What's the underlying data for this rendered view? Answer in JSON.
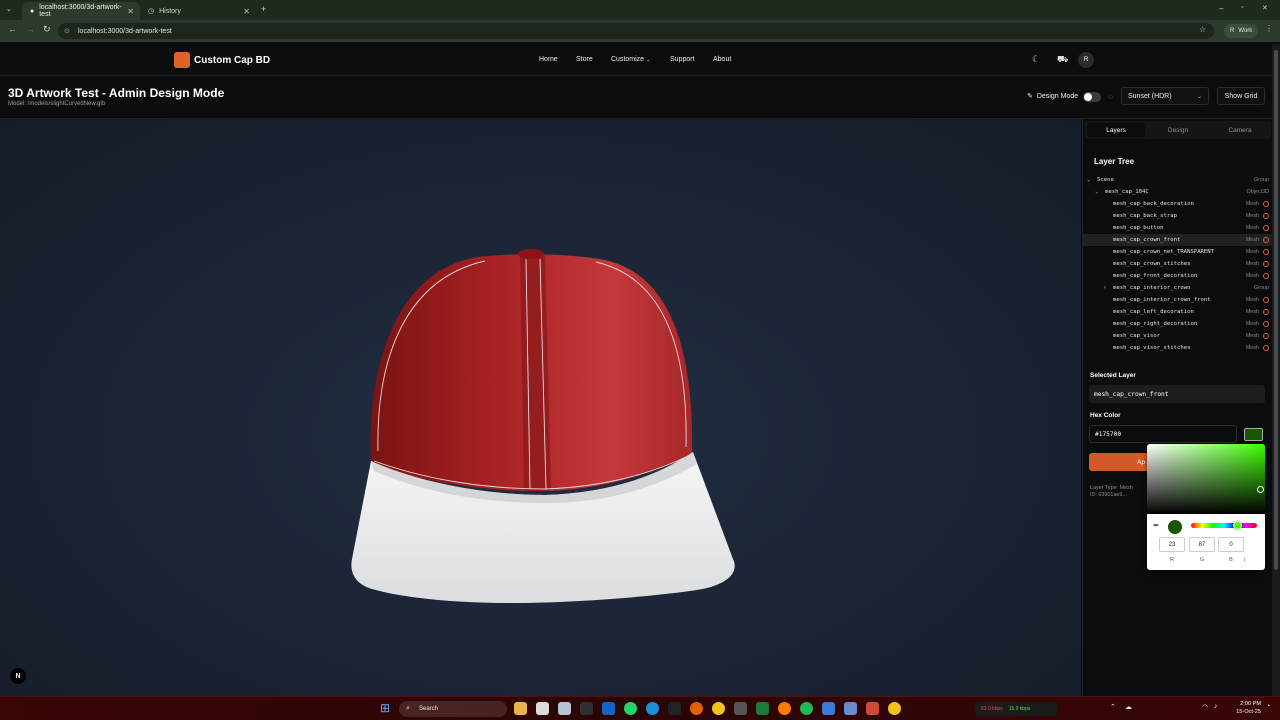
{
  "browser": {
    "tabs": [
      {
        "title": "localhost:3000/3d-artwork-test",
        "active": true
      },
      {
        "title": "History",
        "active": false
      }
    ],
    "url": "localhost:3000/3d-artwork-test",
    "profile": "Work",
    "profile_initial": "R"
  },
  "header": {
    "brand": "Custom Cap BD",
    "nav": [
      "Home",
      "Store",
      "Customize",
      "Support",
      "About"
    ],
    "avatar": "R"
  },
  "page": {
    "title": "3D Artwork Test - Admin Design Mode",
    "model": "Model: /models/slightCurvedNew.glb",
    "design_mode_label": "Design Mode",
    "design_mode_on": false,
    "environment": "Sunset (HDR)",
    "show_grid": "Show Grid"
  },
  "viewport": {
    "cap_crown_color": "#b02a2a",
    "cap_visor_color": "#f2f2f2",
    "badge": "N"
  },
  "panel": {
    "tabs": [
      "Layers",
      "Design",
      "Camera"
    ],
    "active_tab": "Layers",
    "layer_tree_title": "Layer Tree",
    "layers": [
      {
        "name": "Scene",
        "type": "Group",
        "level": 0,
        "expandable": true
      },
      {
        "name": "mesh_cap_104C",
        "type": "Object3D",
        "level": 1,
        "expandable": true
      },
      {
        "name": "mesh_cap_back_decoration",
        "type": "Mesh",
        "level": 2
      },
      {
        "name": "mesh_cap_back_strap",
        "type": "Mesh",
        "level": 2
      },
      {
        "name": "mesh_cap_button",
        "type": "Mesh",
        "level": 2
      },
      {
        "name": "mesh_cap_crown_front",
        "type": "Mesh",
        "level": 2,
        "selected": true
      },
      {
        "name": "mesh_cap_crown_net_TRANSPARENT",
        "type": "Mesh",
        "level": 2
      },
      {
        "name": "mesh_cap_crown_stitches",
        "type": "Mesh",
        "level": 2
      },
      {
        "name": "mesh_cap_front_decoration",
        "type": "Mesh",
        "level": 2
      },
      {
        "name": "mesh_cap_interior_crown",
        "type": "Group",
        "level": 2,
        "expandable": true
      },
      {
        "name": "mesh_cap_interior_crown_front",
        "type": "Mesh",
        "level": 2
      },
      {
        "name": "mesh_cap_left_decoration",
        "type": "Mesh",
        "level": 2
      },
      {
        "name": "mesh_cap_right_decoration",
        "type": "Mesh",
        "level": 2
      },
      {
        "name": "mesh_cap_visor",
        "type": "Mesh",
        "level": 2
      },
      {
        "name": "mesh_cap_visor_stitches",
        "type": "Mesh",
        "level": 2
      }
    ],
    "selected_layer_label": "Selected Layer",
    "selected_layer": "mesh_cap_crown_front",
    "hex_label": "Hex Color",
    "hex_value": "#175700",
    "apply_label": "Ap",
    "layer_type": "Layer Type: Mesh",
    "layer_id": "ID: 63901ae9..."
  },
  "color_picker": {
    "r": "23",
    "g": "87",
    "b": "0",
    "labels": [
      "R",
      "G",
      "B"
    ],
    "hue_color": "#3cff00"
  },
  "taskbar": {
    "search": "Search",
    "net_down": "63.0 kbps",
    "net_up": "15.9 kbps",
    "time": "2:00 PM",
    "date": "15-Oct-25"
  }
}
